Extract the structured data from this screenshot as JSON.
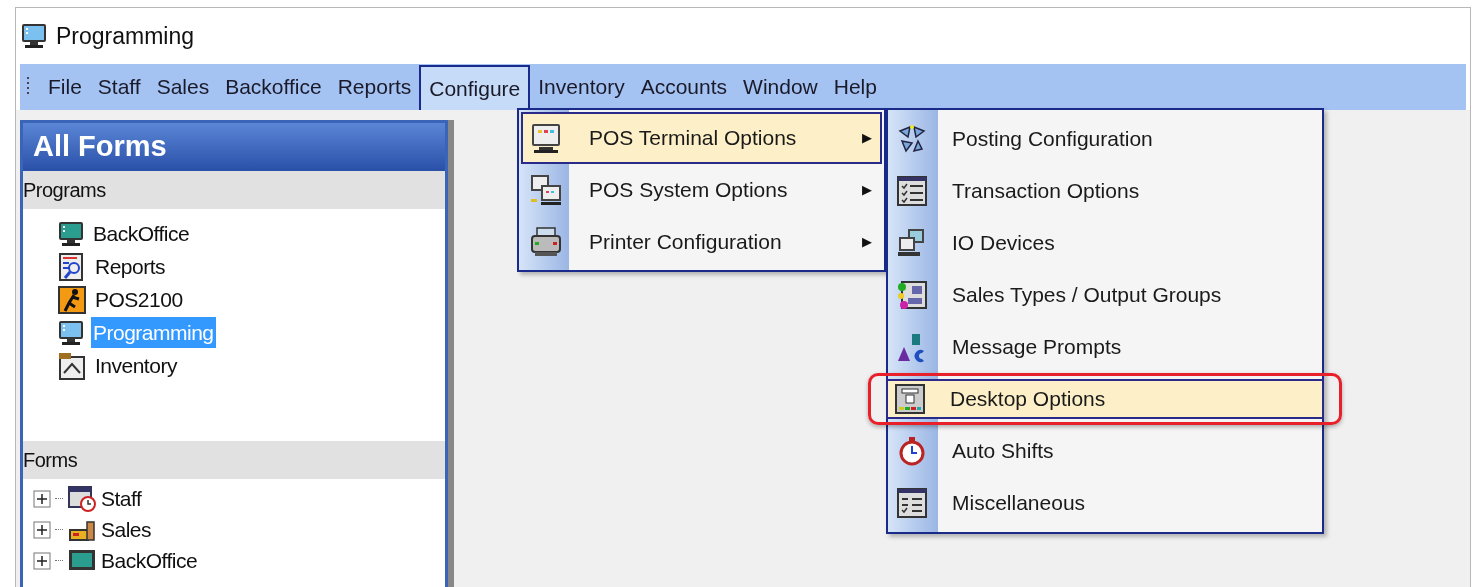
{
  "window": {
    "title": "Programming"
  },
  "menu_bar": [
    {
      "label": "File",
      "selected": false
    },
    {
      "label": "Staff",
      "selected": false
    },
    {
      "label": "Sales",
      "selected": false
    },
    {
      "label": "Backoffice",
      "selected": false
    },
    {
      "label": "Reports",
      "selected": false
    },
    {
      "label": "Configure",
      "selected": true
    },
    {
      "label": "Inventory",
      "selected": false
    },
    {
      "label": "Accounts",
      "selected": false
    },
    {
      "label": "Window",
      "selected": false
    },
    {
      "label": "Help",
      "selected": false
    }
  ],
  "sidebar": {
    "title": "All Forms",
    "programs": {
      "heading": "Programs",
      "items": [
        {
          "label": "BackOffice",
          "selected": false
        },
        {
          "label": "Reports",
          "selected": false
        },
        {
          "label": "POS2100",
          "selected": false
        },
        {
          "label": "Programming",
          "selected": true
        },
        {
          "label": "Inventory",
          "selected": false
        }
      ]
    },
    "forms": {
      "heading": "Forms",
      "items": [
        {
          "label": "Staff",
          "expanded": false
        },
        {
          "label": "Sales",
          "expanded": false
        },
        {
          "label": "BackOffice",
          "expanded": false
        }
      ]
    }
  },
  "configure_menu": [
    {
      "label": "POS Terminal Options",
      "selected": true,
      "arrow": "▶"
    },
    {
      "label": "POS System Options",
      "selected": false,
      "arrow": "▶"
    },
    {
      "label": "Printer Configuration",
      "selected": false,
      "arrow": "▶"
    }
  ],
  "terminal_submenu": [
    {
      "label": "Posting Configuration",
      "selected": false,
      "callout": false
    },
    {
      "label": "Transaction Options",
      "selected": false,
      "callout": false
    },
    {
      "label": "IO Devices",
      "selected": false,
      "callout": false
    },
    {
      "label": "Sales Types / Output Groups",
      "selected": false,
      "callout": false
    },
    {
      "label": "Message Prompts",
      "selected": false,
      "callout": false
    },
    {
      "label": "Desktop Options",
      "selected": true,
      "callout": true
    },
    {
      "label": "Auto Shifts",
      "selected": false,
      "callout": false
    },
    {
      "label": "Miscellaneous",
      "selected": false,
      "callout": false
    }
  ]
}
